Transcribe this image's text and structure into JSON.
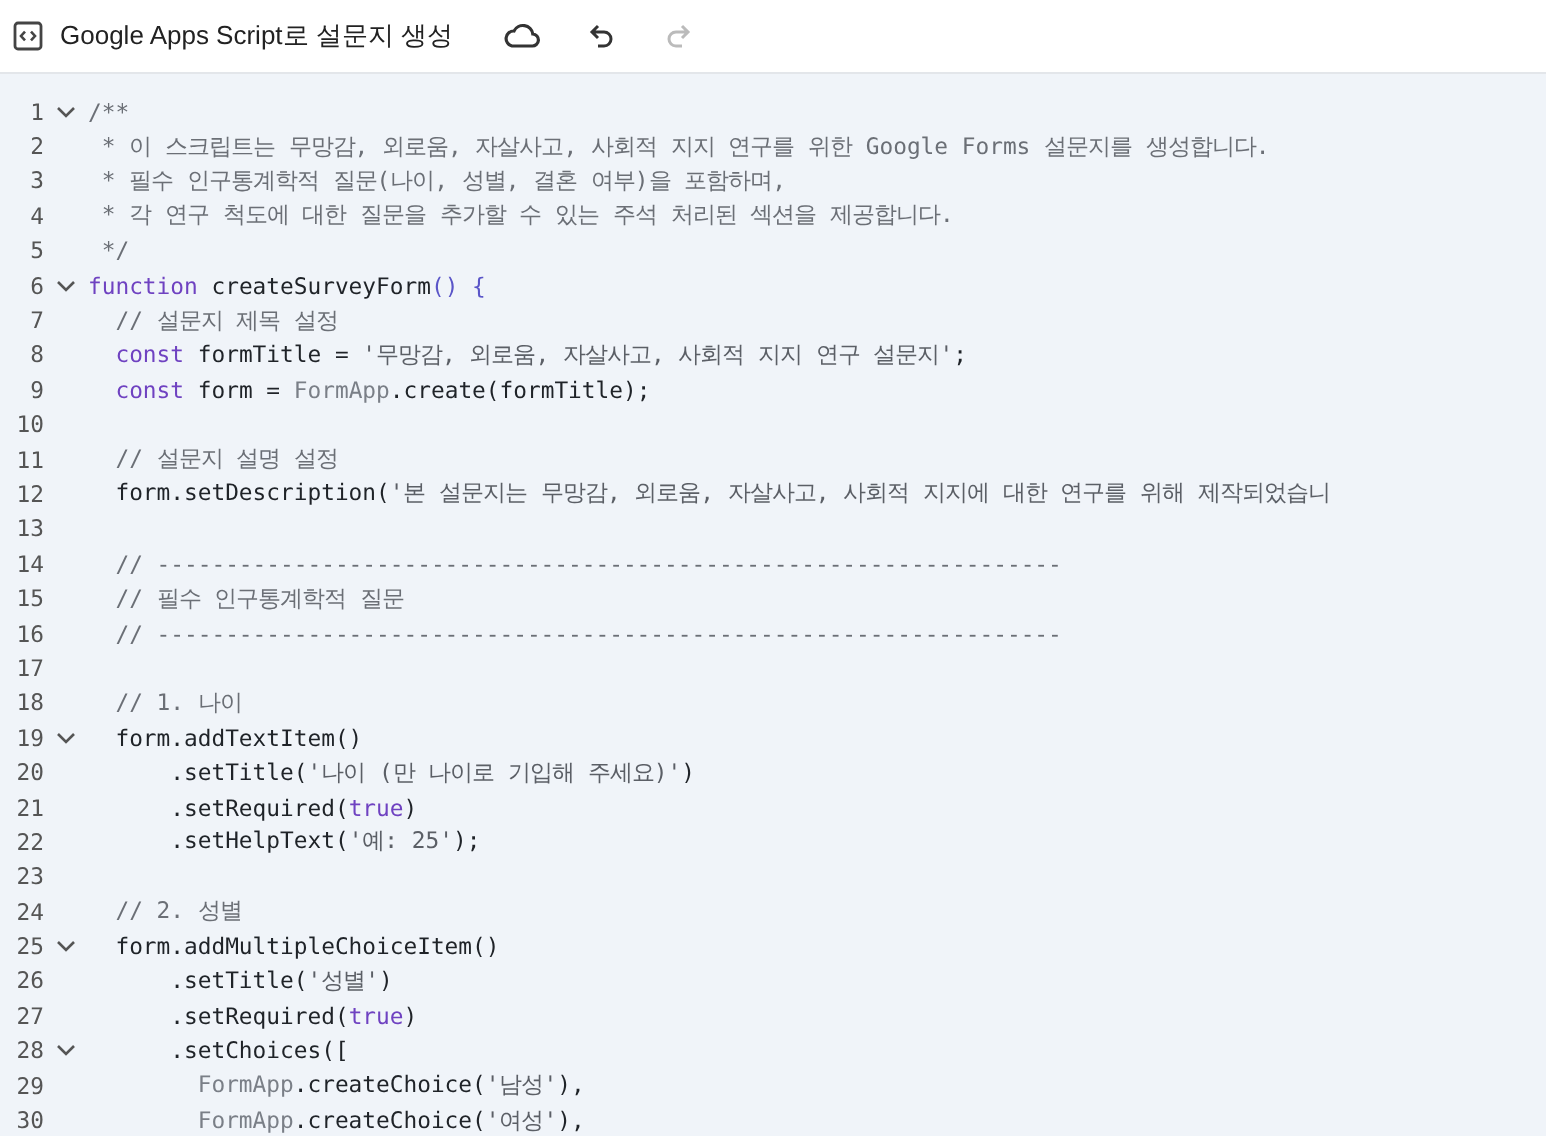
{
  "header": {
    "title": "Google Apps Script로 설문지 생성",
    "redo_disabled": true
  },
  "lines": [
    {
      "number": "1",
      "expanded": true,
      "tokens": [
        {
          "kind": "comment",
          "text": "/**"
        }
      ]
    },
    {
      "number": "2",
      "tokens": [
        {
          "kind": "comment",
          "text": " * 이 스크립트는 무망감, 외로움, 자살사고, 사회적 지지 연구를 위한 Google Forms 설문지를 생성합니다."
        }
      ]
    },
    {
      "number": "3",
      "tokens": [
        {
          "kind": "comment",
          "text": " * 필수 인구통계학적 질문(나이, 성별, 결혼 여부)을 포함하며,"
        }
      ]
    },
    {
      "number": "4",
      "tokens": [
        {
          "kind": "comment",
          "text": " * 각 연구 척도에 대한 질문을 추가할 수 있는 주석 처리된 섹션을 제공합니다."
        }
      ]
    },
    {
      "number": "5",
      "tokens": [
        {
          "kind": "comment",
          "text": " */"
        }
      ]
    },
    {
      "number": "6",
      "expanded": true,
      "tokens": [
        {
          "kind": "keyword",
          "text": "function"
        },
        {
          "kind": "plain",
          "text": " createSurveyForm"
        },
        {
          "kind": "punct",
          "text": "() {"
        }
      ]
    },
    {
      "number": "7",
      "tokens": [
        {
          "kind": "comment",
          "text": "  // 설문지 제목 설정"
        }
      ]
    },
    {
      "number": "8",
      "tokens": [
        {
          "kind": "keyword",
          "text": "  const"
        },
        {
          "kind": "plain",
          "text": " formTitle = "
        },
        {
          "kind": "string",
          "text": "'무망감, 외로움, 자살사고, 사회적 지지 연구 설문지'"
        },
        {
          "kind": "plain",
          "text": ";"
        }
      ]
    },
    {
      "number": "9",
      "tokens": [
        {
          "kind": "keyword",
          "text": "  const"
        },
        {
          "kind": "plain",
          "text": " form = "
        },
        {
          "kind": "type",
          "text": "FormApp"
        },
        {
          "kind": "plain",
          "text": ".create(formTitle);"
        }
      ]
    },
    {
      "number": "10"
    },
    {
      "number": "11",
      "tokens": [
        {
          "kind": "comment",
          "text": "  // 설문지 설명 설정"
        }
      ]
    },
    {
      "number": "12",
      "tokens": [
        {
          "kind": "plain",
          "text": "  form.setDescription("
        },
        {
          "kind": "string",
          "text": "'본 설문지는 무망감, 외로움, 자살사고, 사회적 지지에 대한 연구를 위해 제작되었습니"
        }
      ]
    },
    {
      "number": "13"
    },
    {
      "number": "14",
      "tokens": [
        {
          "kind": "comment",
          "text": "  // ------------------------------------------------------------------"
        }
      ]
    },
    {
      "number": "15",
      "tokens": [
        {
          "kind": "comment",
          "text": "  // 필수 인구통계학적 질문"
        }
      ]
    },
    {
      "number": "16",
      "tokens": [
        {
          "kind": "comment",
          "text": "  // ------------------------------------------------------------------"
        }
      ]
    },
    {
      "number": "17"
    },
    {
      "number": "18",
      "tokens": [
        {
          "kind": "comment",
          "text": "  // 1. 나이"
        }
      ]
    },
    {
      "number": "19",
      "expanded": true,
      "tokens": [
        {
          "kind": "plain",
          "text": "  form.addTextItem()"
        }
      ]
    },
    {
      "number": "20",
      "tokens": [
        {
          "kind": "plain",
          "text": "      .setTitle("
        },
        {
          "kind": "string",
          "text": "'나이 (만 나이로 기입해 주세요)'"
        },
        {
          "kind": "plain",
          "text": ")"
        }
      ]
    },
    {
      "number": "21",
      "tokens": [
        {
          "kind": "plain",
          "text": "      .setRequired("
        },
        {
          "kind": "keyword",
          "text": "true"
        },
        {
          "kind": "plain",
          "text": ")"
        }
      ]
    },
    {
      "number": "22",
      "tokens": [
        {
          "kind": "plain",
          "text": "      .setHelpText("
        },
        {
          "kind": "string",
          "text": "'예: 25'"
        },
        {
          "kind": "plain",
          "text": ");"
        }
      ]
    },
    {
      "number": "23"
    },
    {
      "number": "24",
      "tokens": [
        {
          "kind": "comment",
          "text": "  // 2. 성별"
        }
      ]
    },
    {
      "number": "25",
      "expanded": true,
      "tokens": [
        {
          "kind": "plain",
          "text": "  form.addMultipleChoiceItem()"
        }
      ]
    },
    {
      "number": "26",
      "tokens": [
        {
          "kind": "plain",
          "text": "      .setTitle("
        },
        {
          "kind": "string",
          "text": "'성별'"
        },
        {
          "kind": "plain",
          "text": ")"
        }
      ]
    },
    {
      "number": "27",
      "tokens": [
        {
          "kind": "plain",
          "text": "      .setRequired("
        },
        {
          "kind": "keyword",
          "text": "true"
        },
        {
          "kind": "plain",
          "text": ")"
        }
      ]
    },
    {
      "number": "28",
      "expanded": true,
      "tokens": [
        {
          "kind": "plain",
          "text": "      .setChoices(["
        }
      ]
    },
    {
      "number": "29",
      "tokens": [
        {
          "kind": "type",
          "text": "        FormApp"
        },
        {
          "kind": "plain",
          "text": ".createChoice("
        },
        {
          "kind": "string",
          "text": "'남성'"
        },
        {
          "kind": "plain",
          "text": "),"
        }
      ]
    },
    {
      "number": "30",
      "tokens": [
        {
          "kind": "type",
          "text": "        FormApp"
        },
        {
          "kind": "plain",
          "text": ".createChoice("
        },
        {
          "kind": "string",
          "text": "'여성'"
        },
        {
          "kind": "plain",
          "text": "),"
        }
      ]
    }
  ]
}
